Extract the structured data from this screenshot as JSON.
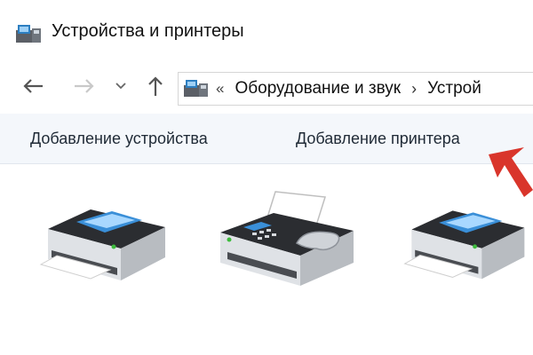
{
  "window": {
    "title": "Устройства и принтеры"
  },
  "navigation": {
    "address_overflow": "«",
    "address_segments": [
      "Оборудование и звук",
      "Устрой"
    ],
    "separator": "›"
  },
  "command_bar": {
    "add_device_label": "Добавление устройства",
    "add_printer_label": "Добавление принтера"
  },
  "annotation": {
    "arrow_color": "#d9352b"
  },
  "devices": [
    {
      "icon": "printer-icon"
    },
    {
      "icon": "fax-icon"
    },
    {
      "icon": "printer-icon"
    }
  ]
}
